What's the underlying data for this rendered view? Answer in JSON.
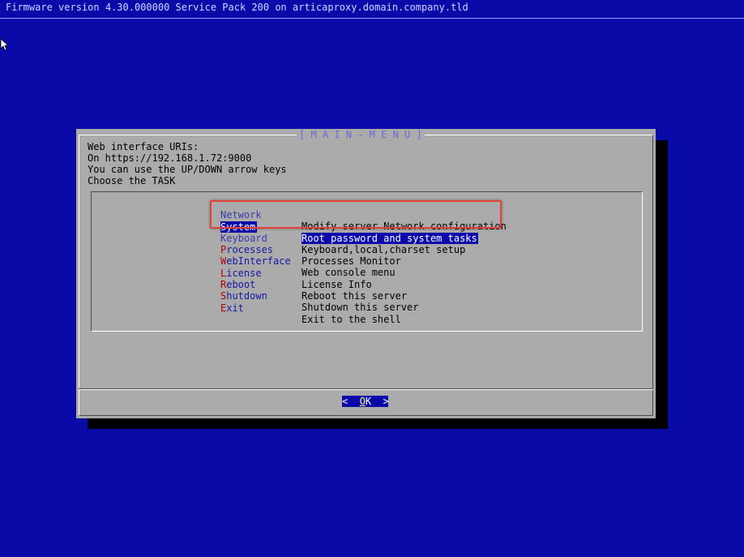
{
  "header": {
    "firmware_text": "Firmware version 4.30.000000 Service Pack 200 on articaproxy.domain.company.tld"
  },
  "dialog": {
    "title": "[ M A I N - M E N U ]",
    "lines": [
      "Web interface URIs:",
      "On https://192.168.1.72:9000",
      "You can use the UP/DOWN arrow keys",
      "Choose the TASK"
    ],
    "menu_items": [
      {
        "hotkey": "N",
        "rest": "etwork",
        "description": "Modify server Network configuration",
        "selected": false
      },
      {
        "hotkey": "S",
        "rest": "ystem",
        "description": "Root password and system tasks",
        "selected": true
      },
      {
        "hotkey": "K",
        "rest": "eyboard",
        "description": "Keyboard,local,charset setup",
        "selected": false
      },
      {
        "hotkey": "P",
        "rest": "rocesses",
        "description": "Processes Monitor",
        "selected": false
      },
      {
        "hotkey": "W",
        "rest": "ebInterface",
        "description": "Web console menu",
        "selected": false
      },
      {
        "hotkey": "L",
        "rest": "icense",
        "description": "License Info",
        "selected": false
      },
      {
        "hotkey": "R",
        "rest": "eboot",
        "description": "Reboot this server",
        "selected": false
      },
      {
        "hotkey": "S",
        "rest": "hutdown",
        "description": "Shutdown this server",
        "selected": false
      },
      {
        "hotkey": "E",
        "rest": "xit",
        "description": "Exit to the shell",
        "selected": false
      }
    ],
    "ok_button": {
      "left": "<  ",
      "hotkey": "O",
      "rest": "K",
      "right": "  >"
    }
  },
  "colors": {
    "background": "#0a0aa9",
    "dialog": "#ababab",
    "hotkey": "#b30000",
    "annotation": "#e3413a"
  }
}
